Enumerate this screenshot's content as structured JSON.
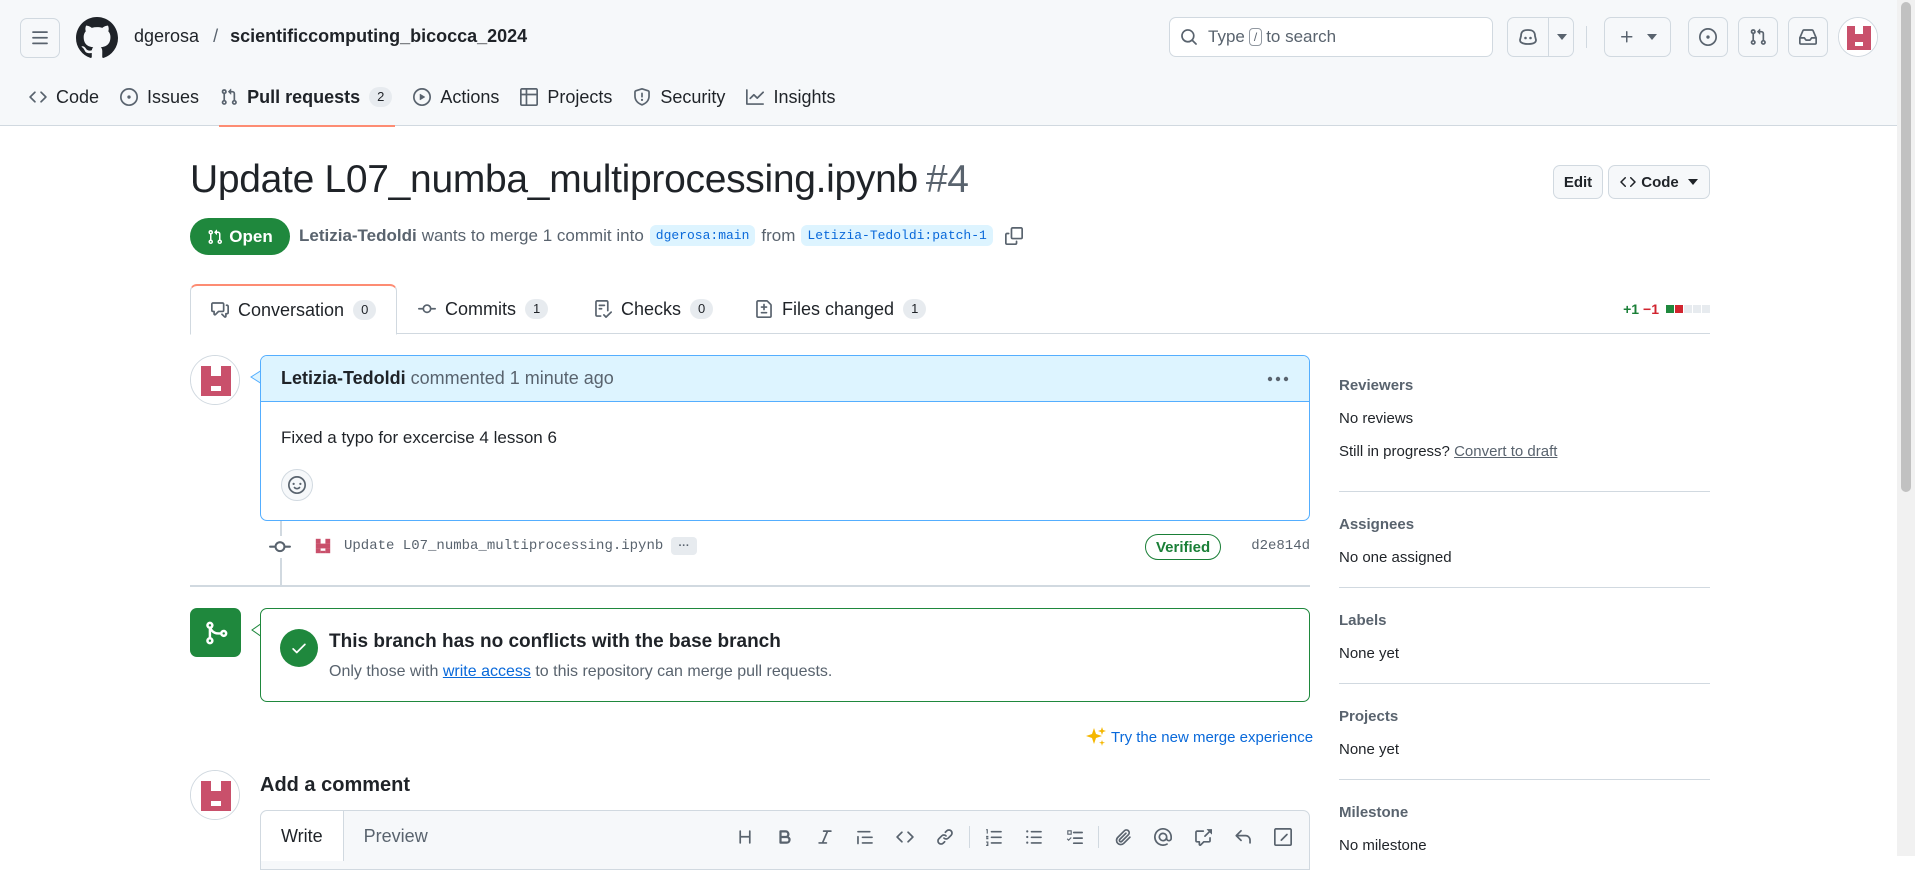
{
  "colors": {
    "accent": "#0969da",
    "success": "#1f883d",
    "danger": "#d1242f",
    "tab_underline": "#fd8c73",
    "avatar": "#c9506b"
  },
  "header": {
    "owner": "dgerosa",
    "separator": "/",
    "repo": "scientificcomputing_bicocca_2024",
    "search_prefix": "Type",
    "search_key": "/",
    "search_suffix": "to search"
  },
  "repo_tabs": [
    {
      "label": "Code",
      "icon": "code-icon"
    },
    {
      "label": "Issues",
      "icon": "issue-opened-icon"
    },
    {
      "label": "Pull requests",
      "icon": "git-pull-request-icon",
      "count": "2"
    },
    {
      "label": "Actions",
      "icon": "play-icon"
    },
    {
      "label": "Projects",
      "icon": "table-icon"
    },
    {
      "label": "Security",
      "icon": "shield-icon"
    },
    {
      "label": "Insights",
      "icon": "graph-icon"
    }
  ],
  "pr": {
    "title": "Update L07_numba_multiprocessing.ipynb",
    "number": "#4",
    "edit_label": "Edit",
    "code_label": "Code",
    "state": "Open",
    "author": "Letizia-Tedoldi",
    "meta_text": "wants to merge 1 commit into",
    "base_branch": "dgerosa:main",
    "from_text": "from",
    "head_branch": "Letizia-Tedoldi:patch-1"
  },
  "pr_tabs": [
    {
      "label": "Conversation",
      "count": "0",
      "icon": "comment-discussion-icon"
    },
    {
      "label": "Commits",
      "count": "1",
      "icon": "git-commit-icon"
    },
    {
      "label": "Checks",
      "count": "0",
      "icon": "checklist-icon"
    },
    {
      "label": "Files changed",
      "count": "1",
      "icon": "file-diff-icon"
    }
  ],
  "diffstat": {
    "additions": "+1",
    "deletions": "−1"
  },
  "comment": {
    "author": "Letizia-Tedoldi",
    "action": "commented",
    "time": "1 minute ago",
    "body": "Fixed a typo for excercise 4 lesson 6"
  },
  "commit": {
    "message": "Update L07_numba_multiprocessing.ipynb",
    "ellipsis": "···",
    "verified": "Verified",
    "sha": "d2e814d"
  },
  "merge": {
    "title": "This branch has no conflicts with the base branch",
    "sub_before": "Only those with",
    "sub_link": "write access",
    "sub_after": "to this repository can merge pull requests.",
    "try_new": "Try the new merge experience"
  },
  "add_comment": {
    "title": "Add a comment",
    "tab_write": "Write",
    "tab_preview": "Preview"
  },
  "sidebar": {
    "reviewers": {
      "heading": "Reviewers",
      "value": "No reviews",
      "progress_text": "Still in progress?",
      "convert_link": "Convert to draft"
    },
    "assignees": {
      "heading": "Assignees",
      "value": "No one assigned"
    },
    "labels": {
      "heading": "Labels",
      "value": "None yet"
    },
    "projects": {
      "heading": "Projects",
      "value": "None yet"
    },
    "milestone": {
      "heading": "Milestone",
      "value": "No milestone"
    }
  }
}
